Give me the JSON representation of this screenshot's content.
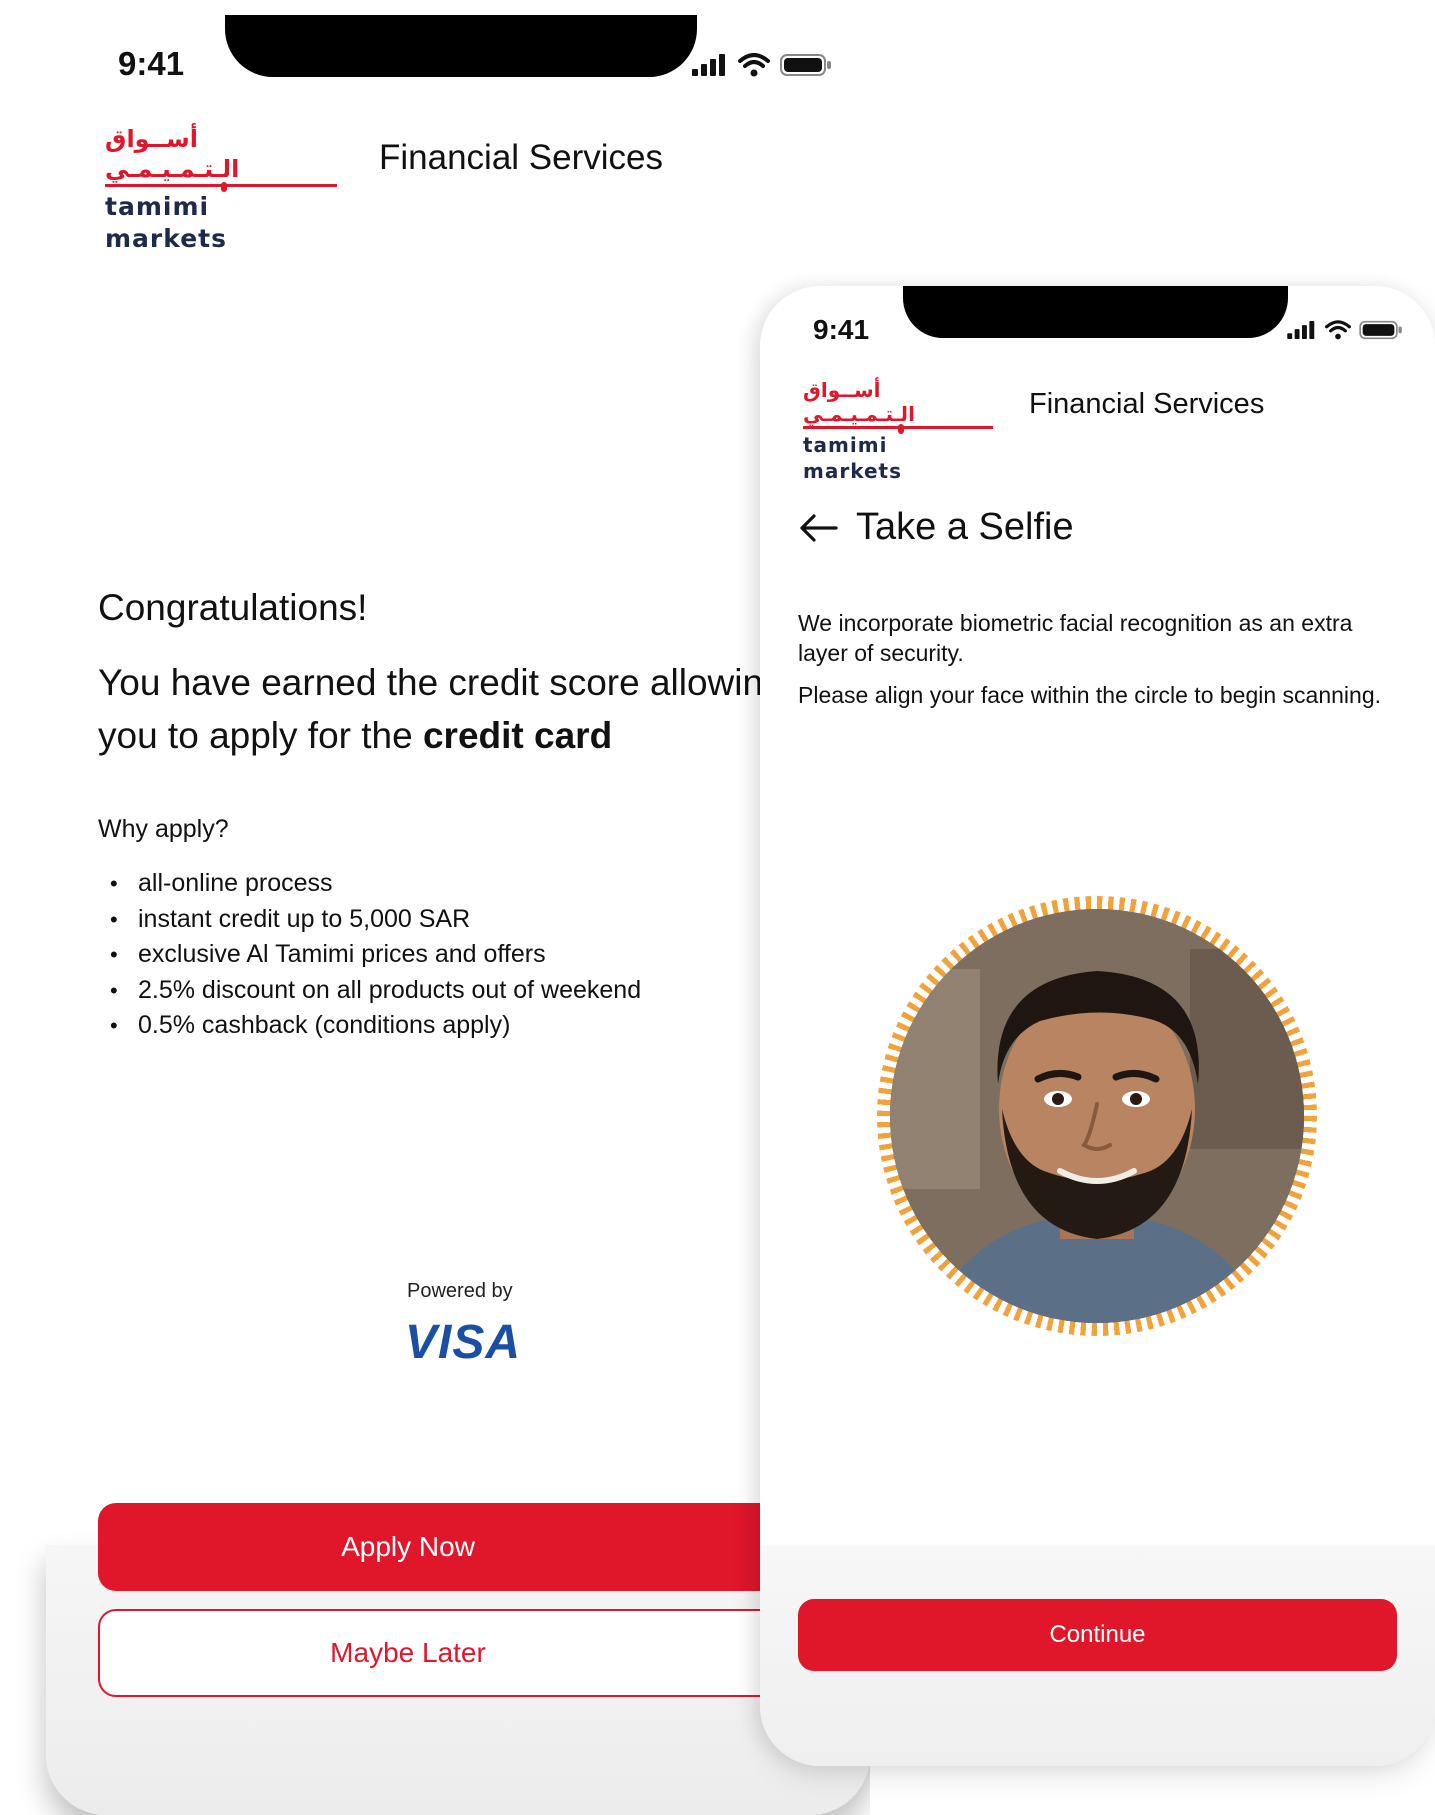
{
  "back_screen": {
    "status_time": "9:41",
    "logo": {
      "arabic": "أســواق الـتـمـيـمـي",
      "latin": "tamimi markets"
    },
    "brand_title": "Financial Services",
    "congrats": "Congratulations!",
    "earned_line1": "You have earned the credit score allowin",
    "earned_line2_prefix": "you to apply for the ",
    "earned_line2_bold": "credit card",
    "why_apply": "Why apply?",
    "benefits": [
      "all-online process",
      "instant credit up to 5,000 SAR",
      "exclusive Al Tamimi prices and offers",
      "2.5% discount on all products out of weekend",
      "0.5% cashback (conditions apply)"
    ],
    "powered_by": "Powered by",
    "visa": "VISA",
    "apply_button": "Apply Now",
    "later_button": "Maybe Later"
  },
  "front_screen": {
    "status_time": "9:41",
    "logo": {
      "arabic": "أســواق الـتـمـيـمـي",
      "latin": "tamimi markets"
    },
    "brand_title": "Financial Services",
    "title": "Take a Selfie",
    "description_1": "We incorporate biometric facial recognition as an extra layer of security.",
    "description_2": "Please align your face within the circle to begin scanning.",
    "continue_button": "Continue"
  },
  "icons": [
    "signal-icon",
    "wifi-icon",
    "battery-icon",
    "back-arrow-icon"
  ],
  "colors": {
    "brand_red": "#e0162b",
    "navy": "#1e2a4a",
    "visa_blue": "#1a4fa3",
    "ring_orange": "#f2a23a"
  }
}
